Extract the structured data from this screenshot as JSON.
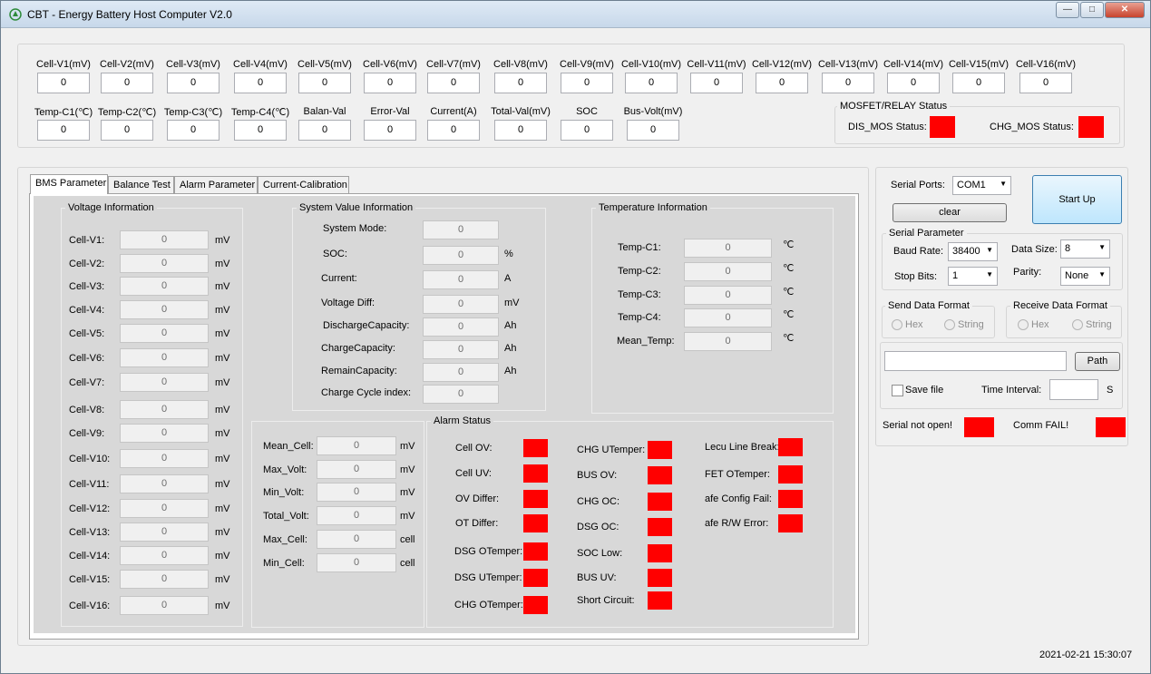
{
  "window": {
    "title": "CBT - Energy Battery Host Computer V2.0",
    "btn_min": "—",
    "btn_max": "□",
    "btn_close": "✕"
  },
  "top": {
    "cells": [
      {
        "label": "Cell-V1(mV)",
        "value": "0"
      },
      {
        "label": "Cell-V2(mV)",
        "value": "0"
      },
      {
        "label": "Cell-V3(mV)",
        "value": "0"
      },
      {
        "label": "Cell-V4(mV)",
        "value": "0"
      },
      {
        "label": "Cell-V5(mV)",
        "value": "0"
      },
      {
        "label": "Cell-V6(mV)",
        "value": "0"
      },
      {
        "label": "Cell-V7(mV)",
        "value": "0"
      },
      {
        "label": "Cell-V8(mV)",
        "value": "0"
      },
      {
        "label": "Cell-V9(mV)",
        "value": "0"
      },
      {
        "label": "Cell-V10(mV)",
        "value": "0"
      },
      {
        "label": "Cell-V11(mV)",
        "value": "0"
      },
      {
        "label": "Cell-V12(mV)",
        "value": "0"
      },
      {
        "label": "Cell-V13(mV)",
        "value": "0"
      },
      {
        "label": "Cell-V14(mV)",
        "value": "0"
      },
      {
        "label": "Cell-V15(mV)",
        "value": "0"
      },
      {
        "label": "Cell-V16(mV)",
        "value": "0"
      }
    ],
    "row2": [
      {
        "label": "Temp-C1(℃)",
        "value": "0"
      },
      {
        "label": "Temp-C2(℃)",
        "value": "0"
      },
      {
        "label": "Temp-C3(℃)",
        "value": "0"
      },
      {
        "label": "Temp-C4(℃)",
        "value": "0"
      },
      {
        "label": "Balan-Val",
        "value": "0"
      },
      {
        "label": "Error-Val",
        "value": "0"
      },
      {
        "label": "Current(A)",
        "value": "0"
      },
      {
        "label": "Total-Val(mV)",
        "value": "0"
      },
      {
        "label": "SOC",
        "value": "0"
      },
      {
        "label": "Bus-Volt(mV)",
        "value": "0"
      }
    ],
    "mosfet": {
      "title": "MOSFET/RELAY Status",
      "dis_label": "DIS_MOS Status:",
      "chg_label": "CHG_MOS Status:"
    }
  },
  "tabs": [
    "BMS Parameter",
    "Balance Test",
    "Alarm Parameter",
    "Current-Calibration"
  ],
  "voltage": {
    "title": "Voltage Information",
    "unit": "mV",
    "items": [
      {
        "label": "Cell-V1:",
        "value": "0"
      },
      {
        "label": "Cell-V2:",
        "value": "0"
      },
      {
        "label": "Cell-V3:",
        "value": "0"
      },
      {
        "label": "Cell-V4:",
        "value": "0"
      },
      {
        "label": "Cell-V5:",
        "value": "0"
      },
      {
        "label": "Cell-V6:",
        "value": "0"
      },
      {
        "label": "Cell-V7:",
        "value": "0"
      },
      {
        "label": "Cell-V8:",
        "value": "0"
      },
      {
        "label": "Cell-V9:",
        "value": "0"
      },
      {
        "label": "Cell-V10:",
        "value": "0"
      },
      {
        "label": "Cell-V11:",
        "value": "0"
      },
      {
        "label": "Cell-V12:",
        "value": "0"
      },
      {
        "label": "Cell-V13:",
        "value": "0"
      },
      {
        "label": "Cell-V14:",
        "value": "0"
      },
      {
        "label": "Cell-V15:",
        "value": "0"
      },
      {
        "label": "Cell-V16:",
        "value": "0"
      }
    ]
  },
  "system": {
    "title": "System Value Information",
    "items": [
      {
        "label": "System Mode:",
        "value": "0",
        "unit": ""
      },
      {
        "label": "SOC:",
        "value": "0",
        "unit": "%"
      },
      {
        "label": "Current:",
        "value": "0",
        "unit": "A"
      },
      {
        "label": "Voltage Diff:",
        "value": "0",
        "unit": "mV"
      },
      {
        "label": "DischargeCapacity:",
        "value": "0",
        "unit": "Ah"
      },
      {
        "label": "ChargeCapacity:",
        "value": "0",
        "unit": "Ah"
      },
      {
        "label": "RemainCapacity:",
        "value": "0",
        "unit": "Ah"
      },
      {
        "label": "Charge Cycle index:",
        "value": "0",
        "unit": ""
      }
    ]
  },
  "temperature": {
    "title": "Temperature Information",
    "unit": "℃",
    "items": [
      {
        "label": "Temp-C1:",
        "value": "0"
      },
      {
        "label": "Temp-C2:",
        "value": "0"
      },
      {
        "label": "Temp-C3:",
        "value": "0"
      },
      {
        "label": "Temp-C4:",
        "value": "0"
      },
      {
        "label": "Mean_Temp:",
        "value": "0"
      }
    ]
  },
  "stats": {
    "items": [
      {
        "label": "Mean_Cell:",
        "value": "0",
        "unit": "mV"
      },
      {
        "label": "Max_Volt:",
        "value": "0",
        "unit": "mV"
      },
      {
        "label": "Min_Volt:",
        "value": "0",
        "unit": "mV"
      },
      {
        "label": "Total_Volt:",
        "value": "0",
        "unit": "mV"
      },
      {
        "label": "Max_Cell:",
        "value": "0",
        "unit": "cell"
      },
      {
        "label": "Min_Cell:",
        "value": "0",
        "unit": "cell"
      }
    ]
  },
  "alarm": {
    "title": "Alarm Status",
    "col1": [
      "Cell OV:",
      "Cell UV:",
      "OV Differ:",
      "OT Differ:",
      "DSG OTemper:",
      "DSG UTemper:",
      "CHG OTemper:"
    ],
    "col2": [
      "CHG UTemper:",
      "BUS OV:",
      "CHG OC:",
      "DSG OC:",
      "SOC Low:",
      "BUS UV:",
      "Short Circuit:"
    ],
    "col3": [
      "Lecu Line Break:",
      "FET OTemper:",
      "afe Config Fail:",
      "afe R/W Error:"
    ],
    "indicator_color": "#ff0000"
  },
  "serial": {
    "ports_label": "Serial Ports:",
    "port_value": "COM1",
    "start_label": "Start Up",
    "clear_label": "clear",
    "param_title": "Serial Parameter",
    "baud_label": "Baud Rate:",
    "baud_value": "38400",
    "size_label": "Data Size:",
    "size_value": "8",
    "stop_label": "Stop Bits:",
    "stop_value": "1",
    "parity_label": "Parity:",
    "parity_value": "None",
    "send_title": "Send Data Format",
    "recv_title": "Receive Data Format",
    "hex": "Hex",
    "string": "String",
    "path_label": "Path",
    "save_label": "Save  file",
    "interval_label": "Time Interval:",
    "interval_unit": "S",
    "status_serial": "Serial not open!",
    "status_comm": "Comm FAIL!"
  },
  "statusbar": {
    "datetime": "2021-02-21  15:30:07"
  }
}
